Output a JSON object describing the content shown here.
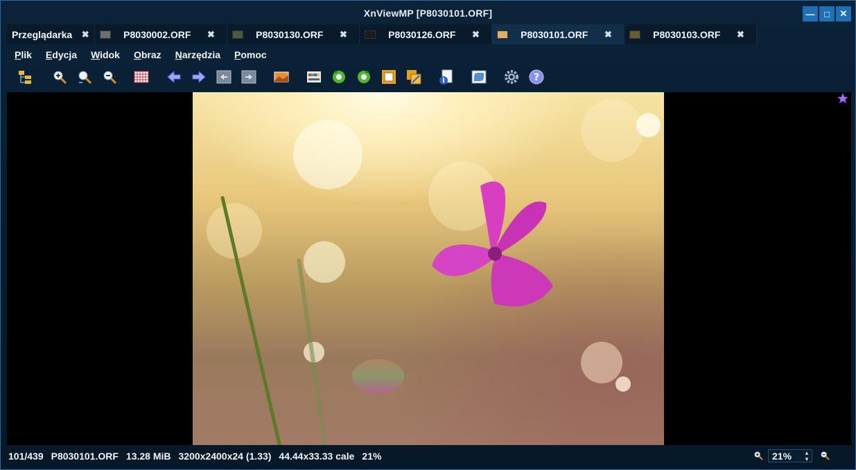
{
  "window": {
    "title": "XnViewMP [P8030101.ORF]"
  },
  "tabs": [
    {
      "label": "Przeglądarka",
      "close": "✖",
      "thumb": ""
    },
    {
      "label": "P8030002.ORF",
      "close": "✖",
      "thumb": "#6b6f70"
    },
    {
      "label": "P8030130.ORF",
      "close": "✖",
      "thumb": "#4a5a40"
    },
    {
      "label": "P8030126.ORF",
      "close": "✖",
      "thumb": "#1c1c1c"
    },
    {
      "label": "P8030101.ORF",
      "close": "✖",
      "thumb": "#e0b060"
    },
    {
      "label": "P8030103.ORF",
      "close": "✖",
      "thumb": "#6a5a30"
    }
  ],
  "menu": [
    {
      "first": "P",
      "rest": "lik"
    },
    {
      "first": "E",
      "rest": "dycja"
    },
    {
      "first": "W",
      "rest": "idok"
    },
    {
      "first": "O",
      "rest": "braz"
    },
    {
      "first": "N",
      "rest": "arzędzia"
    },
    {
      "first": "P",
      "rest": "omoc"
    }
  ],
  "toolbar_icons": [
    "folder-tree-icon",
    "zoom-in-icon",
    "zoom-fit-icon",
    "zoom-out-icon",
    "grid-icon",
    "previous-arrow-icon",
    "next-arrow-icon",
    "previous-page-icon",
    "next-page-icon",
    "slideshow-icon",
    "histogram-icon",
    "rotate-left-icon",
    "rotate-right-icon",
    "crop-icon",
    "resize-icon",
    "info-icon",
    "fullscreen-icon",
    "settings-gear-icon",
    "help-icon"
  ],
  "status": {
    "index": "101/439",
    "filename": "P8030101.ORF",
    "filesize": "13.28 MiB",
    "dimensions": "3200x2400x24 (1.33)",
    "print_size": "44.44x33.33 cale",
    "zoom": "21%"
  },
  "zoom_field": {
    "value": "21%"
  },
  "colors": {
    "accent": "#1e6fb3",
    "background": "#071828",
    "flower": "#d83fc0"
  }
}
